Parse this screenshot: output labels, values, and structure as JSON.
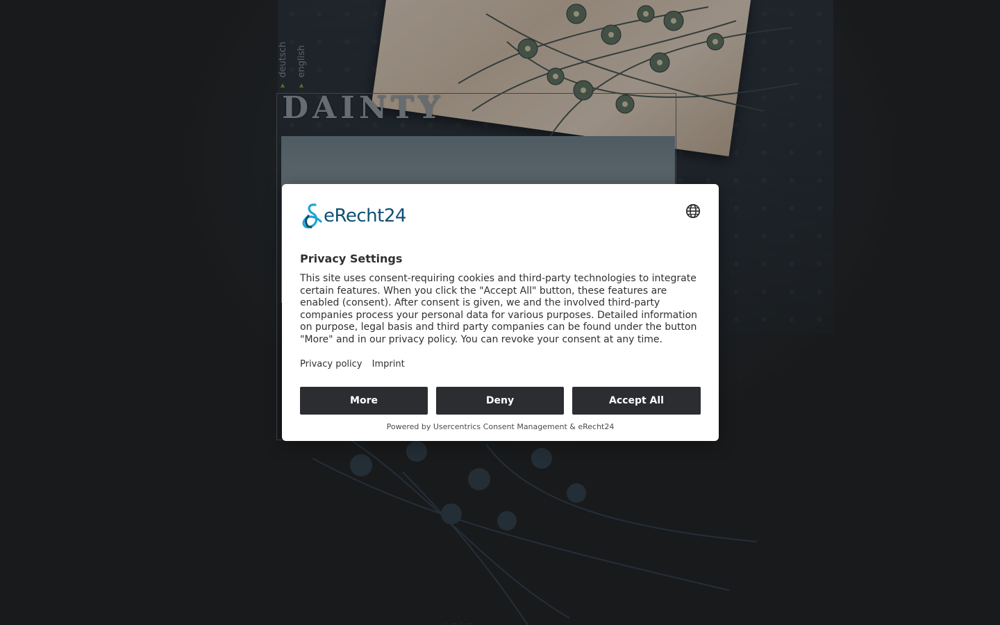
{
  "site": {
    "logo_text": "DAINTY",
    "languages": [
      "deutsch",
      "english"
    ],
    "footer_text": "· ·· · ··"
  },
  "consent": {
    "brand_name": "eRecht24",
    "title": "Privacy Settings",
    "body": "This site uses consent-requiring cookies and third-party technologies to integrate certain features. When you click the \"Accept All\" button, these features are enabled (consent). After consent is given, we and the involved third-party companies process your personal data for various purposes. Detailed information on purpose, legal basis and third party companies can be found under the button \"More\" and in our privacy policy. You can revoke your consent at any time.",
    "links": [
      "Privacy policy",
      "Imprint"
    ],
    "buttons": {
      "more": "More",
      "deny": "Deny",
      "accept": "Accept All"
    },
    "powered_by": "Powered by Usercentrics Consent Management & eRecht24",
    "language_icon": "globe-icon"
  },
  "colors": {
    "background": "#232527",
    "button_bg": "#2b2d31",
    "brand_blue": "#0e4f73",
    "brand_cyan": "#1fa3d6",
    "lang_arrow": "#6f9a3a"
  }
}
